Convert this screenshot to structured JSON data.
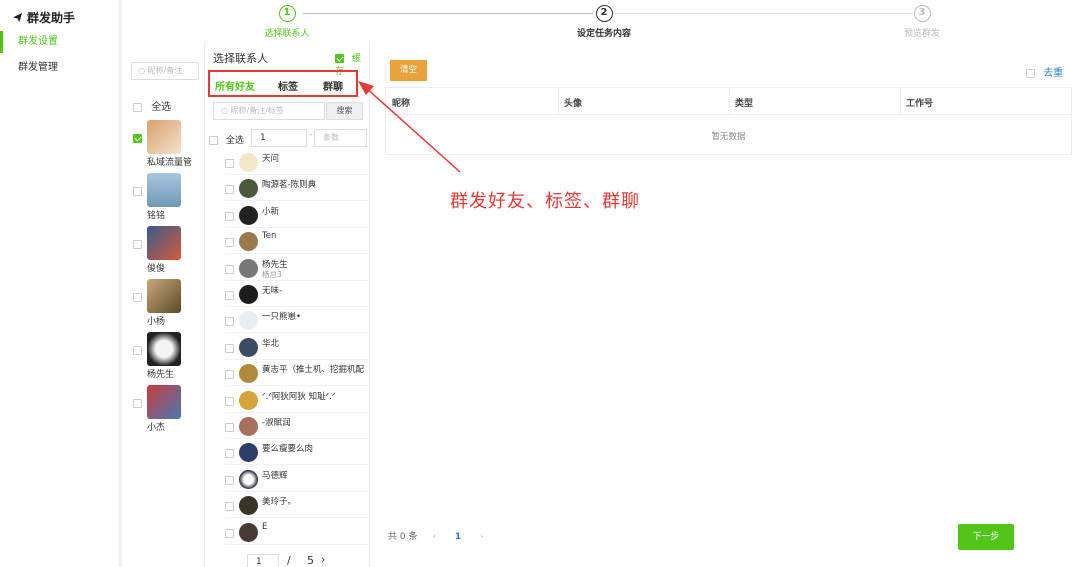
{
  "nav": {
    "title": "群发助手",
    "items": [
      {
        "label": "群发设置",
        "active": true
      },
      {
        "label": "群发管理",
        "active": false
      }
    ]
  },
  "steps": [
    {
      "num": "1",
      "label": "选择联系人",
      "state": "active"
    },
    {
      "num": "2",
      "label": "设定任务内容",
      "state": "current"
    },
    {
      "num": "3",
      "label": "预览群发",
      "state": "pending"
    }
  ],
  "contacts_panel": {
    "search_placeholder": "昵称/备注",
    "select_all": "全选",
    "contacts": [
      {
        "name": "私域流量管",
        "checked": true
      },
      {
        "name": "铭铭",
        "checked": false
      },
      {
        "name": "俊俊",
        "checked": false
      },
      {
        "name": "小杨",
        "checked": false
      },
      {
        "name": "杨先生",
        "checked": false
      },
      {
        "name": "小杰",
        "checked": false
      }
    ]
  },
  "friends_panel": {
    "title": "选择联系人",
    "cache_label": "缓存",
    "cache_checked": true,
    "tabs": [
      {
        "label": "所有好友",
        "active": true
      },
      {
        "label": "标签",
        "active": false
      },
      {
        "label": "群聊",
        "active": false
      }
    ],
    "search_placeholder": "昵称/备注/标签",
    "search_button": "搜索",
    "select_all": "全选",
    "range_from": "1",
    "range_to_placeholder": "条数",
    "friends": [
      {
        "name": "天问",
        "sub": ""
      },
      {
        "name": "陶源茗-陈则典",
        "sub": ""
      },
      {
        "name": "小新",
        "sub": ""
      },
      {
        "name": "Ten",
        "sub": ""
      },
      {
        "name": "杨先生",
        "sub": "杨总3"
      },
      {
        "name": "无味-",
        "sub": ""
      },
      {
        "name": "一只熊崽•",
        "sub": ""
      },
      {
        "name": "华北",
        "sub": ""
      },
      {
        "name": "黄志平（推土机、挖掘机配",
        "sub": ""
      },
      {
        "name": "ᐟ.ᐟ阿狄阿狄 知耻ᐟ.ᐟ",
        "sub": ""
      },
      {
        "name": "-淑賦润",
        "sub": ""
      },
      {
        "name": "要么瘦要么肉",
        "sub": ""
      },
      {
        "name": "马德辉",
        "sub": ""
      },
      {
        "name": "美玲子。",
        "sub": ""
      },
      {
        "name": "E",
        "sub": ""
      }
    ],
    "pager": {
      "current": "1",
      "separator": "/",
      "total": "5",
      "next": "›"
    }
  },
  "selected_panel": {
    "clear_button": "清空",
    "dedup_label": "去重",
    "columns": [
      "昵称",
      "头像",
      "类型",
      "工作号"
    ],
    "empty_text": "暂无数据",
    "total_text": "共 0 条",
    "prev": "‹",
    "page": "1",
    "next": "›",
    "next_step_button": "下一步"
  },
  "annotation": {
    "text": "群发好友、标签、群聊",
    "color": "#e53935"
  },
  "colors": {
    "accent": "#52c41a",
    "warning": "#e8a33c",
    "link": "#2f7fd8"
  }
}
